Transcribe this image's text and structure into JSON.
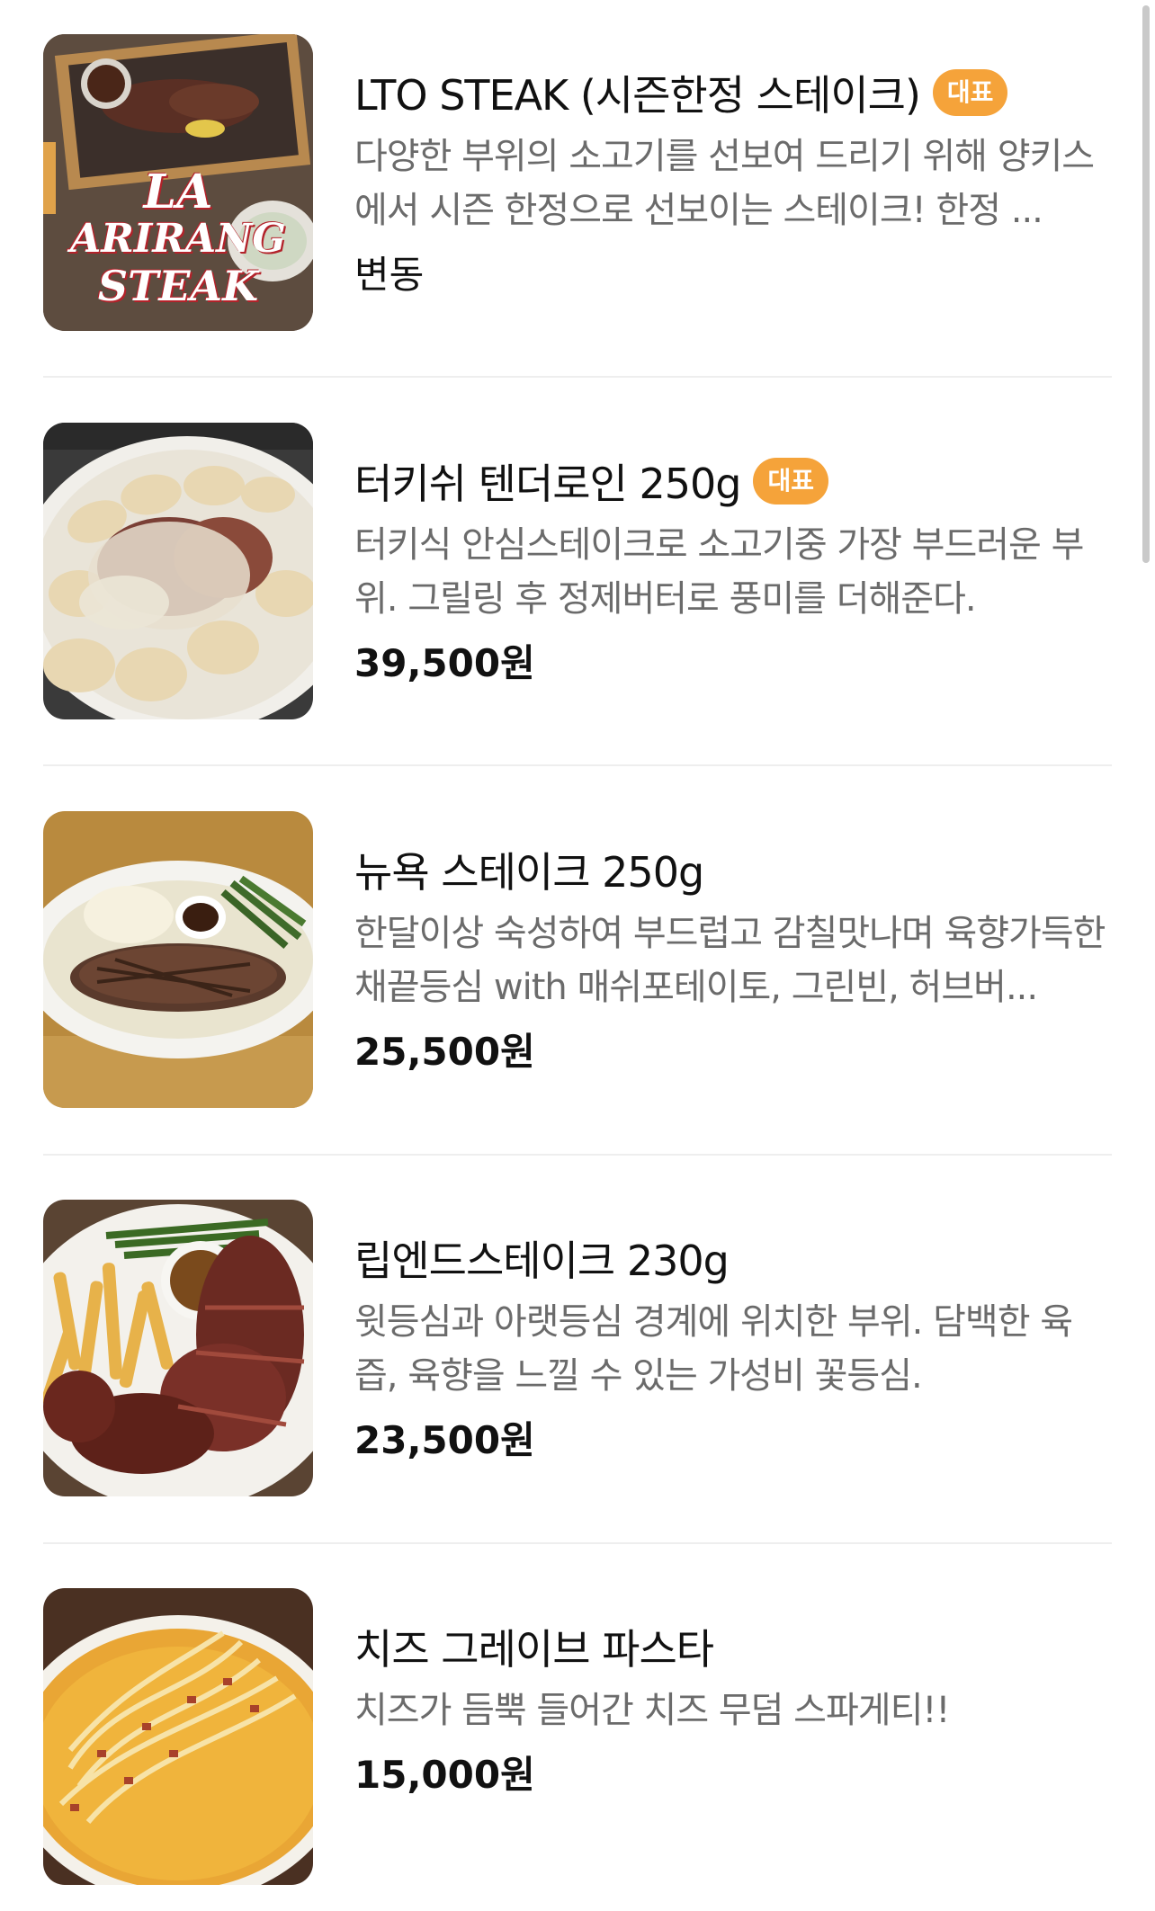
{
  "menu": {
    "items": [
      {
        "title": "LTO STEAK (시즌한정 스테이크)",
        "badge": "대표",
        "description": "다양한 부위의 소고기를 선보여 드리기 위해 양키스에서 시즌 한정으로 선보이는 스테이크! 한정 ...",
        "price": "변동",
        "image_text": [
          "LA",
          "ARIRANG",
          "STEAK"
        ]
      },
      {
        "title": "터키쉬 텐더로인 250g",
        "badge": "대표",
        "description": "터키식 안심스테이크로 소고기중 가장 부드러운 부위. 그릴링 후 정제버터로 풍미를 더해준다.",
        "price": "39,500원"
      },
      {
        "title": "뉴욕 스테이크 250g",
        "description": "한달이상 숙성하여 부드럽고 감칠맛나며 육향가득한 채끝등심 with 매쉬포테이토, 그린빈, 허브버...",
        "price": "25,500원"
      },
      {
        "title": "립엔드스테이크 230g",
        "description": "윗등심과 아랫등심 경계에 위치한 부위. 담백한 육즙, 육향을 느낄 수 있는 가성비 꽃등심.",
        "price": "23,500원"
      },
      {
        "title": "치즈 그레이브 파스타",
        "description": "치즈가 듬뿍 들어간 치즈 무덤 스파게티!!",
        "price": "15,000원"
      }
    ]
  },
  "colors": {
    "badge": "#f5a33a",
    "description": "#6b6b6b",
    "divider": "#eeeeee"
  }
}
